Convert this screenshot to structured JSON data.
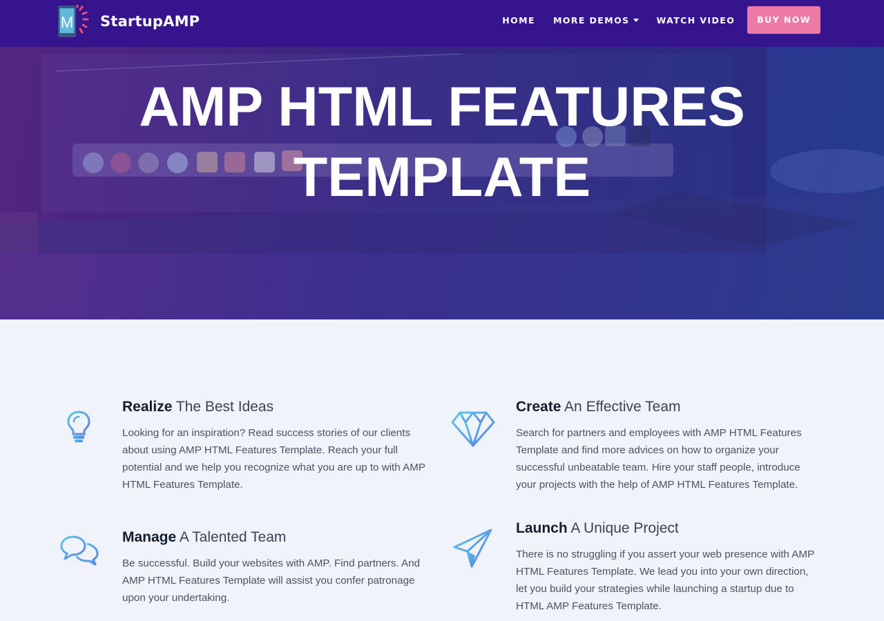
{
  "brand": {
    "name": "StartupAMP",
    "logo_letter": "M"
  },
  "nav": {
    "home": "HOME",
    "more_demos": "MORE DEMOS",
    "watch_video": "WATCH VIDEO",
    "buy_now": "BUY NOW"
  },
  "hero": {
    "title_line1": "AMP HTML FEATURES",
    "title_line2": "TEMPLATE"
  },
  "features": [
    {
      "icon": "lightbulb-icon",
      "bold": "Realize",
      "rest": " The Best Ideas",
      "text": "Looking for an inspiration? Read success stories of our clients about using AMP HTML Features Template. Reach your full potential and we help you recognize what you are up to with AMP HTML Features Template."
    },
    {
      "icon": "diamond-icon",
      "bold": "Create",
      "rest": " An Effective Team",
      "text": "Search for partners and employees with AMP HTML Features Template and find more advices on how to organize your successful unbeatable team. Hire your staff people, introduce your projects with the help of AMP HTML Features Template."
    },
    {
      "icon": "chat-bubbles-icon",
      "bold": "Manage",
      "rest": " A Talented Team",
      "text": "Be successful. Build your websites with AMP. Find partners. And AMP HTML Features Template will assist you confer patronage upon your undertaking."
    },
    {
      "icon": "paper-plane-icon",
      "bold": "Launch",
      "rest": " A Unique Project",
      "text": "There is no struggling if you assert your web presence with AMP HTML Features Template. We lead you into your own direction, let you build your strategies while launching a startup due to HTML AMP Features Template."
    }
  ],
  "colors": {
    "navbar": "#36148e",
    "buy_button": "#ec7aa5",
    "icon_gradient_start": "#5ac8e6",
    "icon_gradient_end": "#5a7ee6"
  }
}
